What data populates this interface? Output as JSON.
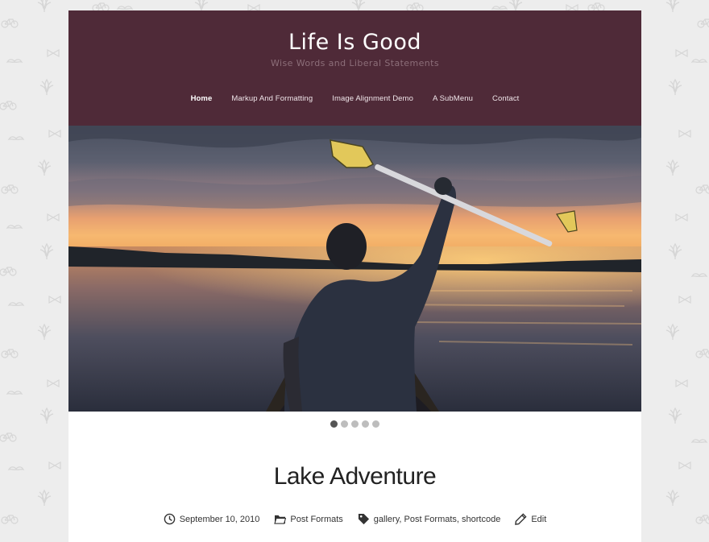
{
  "site": {
    "title": "Life Is Good",
    "description": "Wise Words and Liberal Statements"
  },
  "nav": {
    "items": [
      {
        "label": "Home",
        "active": true
      },
      {
        "label": "Markup And Formatting",
        "active": false
      },
      {
        "label": "Image Alignment Demo",
        "active": false
      },
      {
        "label": "A SubMenu",
        "active": false
      },
      {
        "label": "Contact",
        "active": false
      }
    ]
  },
  "slider": {
    "slide_count": 5,
    "active_index": 0
  },
  "post": {
    "title": "Lake Adventure",
    "date": "September 10, 2010",
    "category": "Post Formats",
    "tags": "gallery, Post Formats, shortcode",
    "edit_label": "Edit"
  },
  "colors": {
    "header_bg": "#4f2a38",
    "page_bg": "#ededed",
    "dot_active": "#555555",
    "dot_inactive": "#bdbdbd"
  },
  "icons": {
    "date": "clock-icon",
    "category": "folder-icon",
    "tags": "tag-icon",
    "edit": "pencil-icon"
  }
}
